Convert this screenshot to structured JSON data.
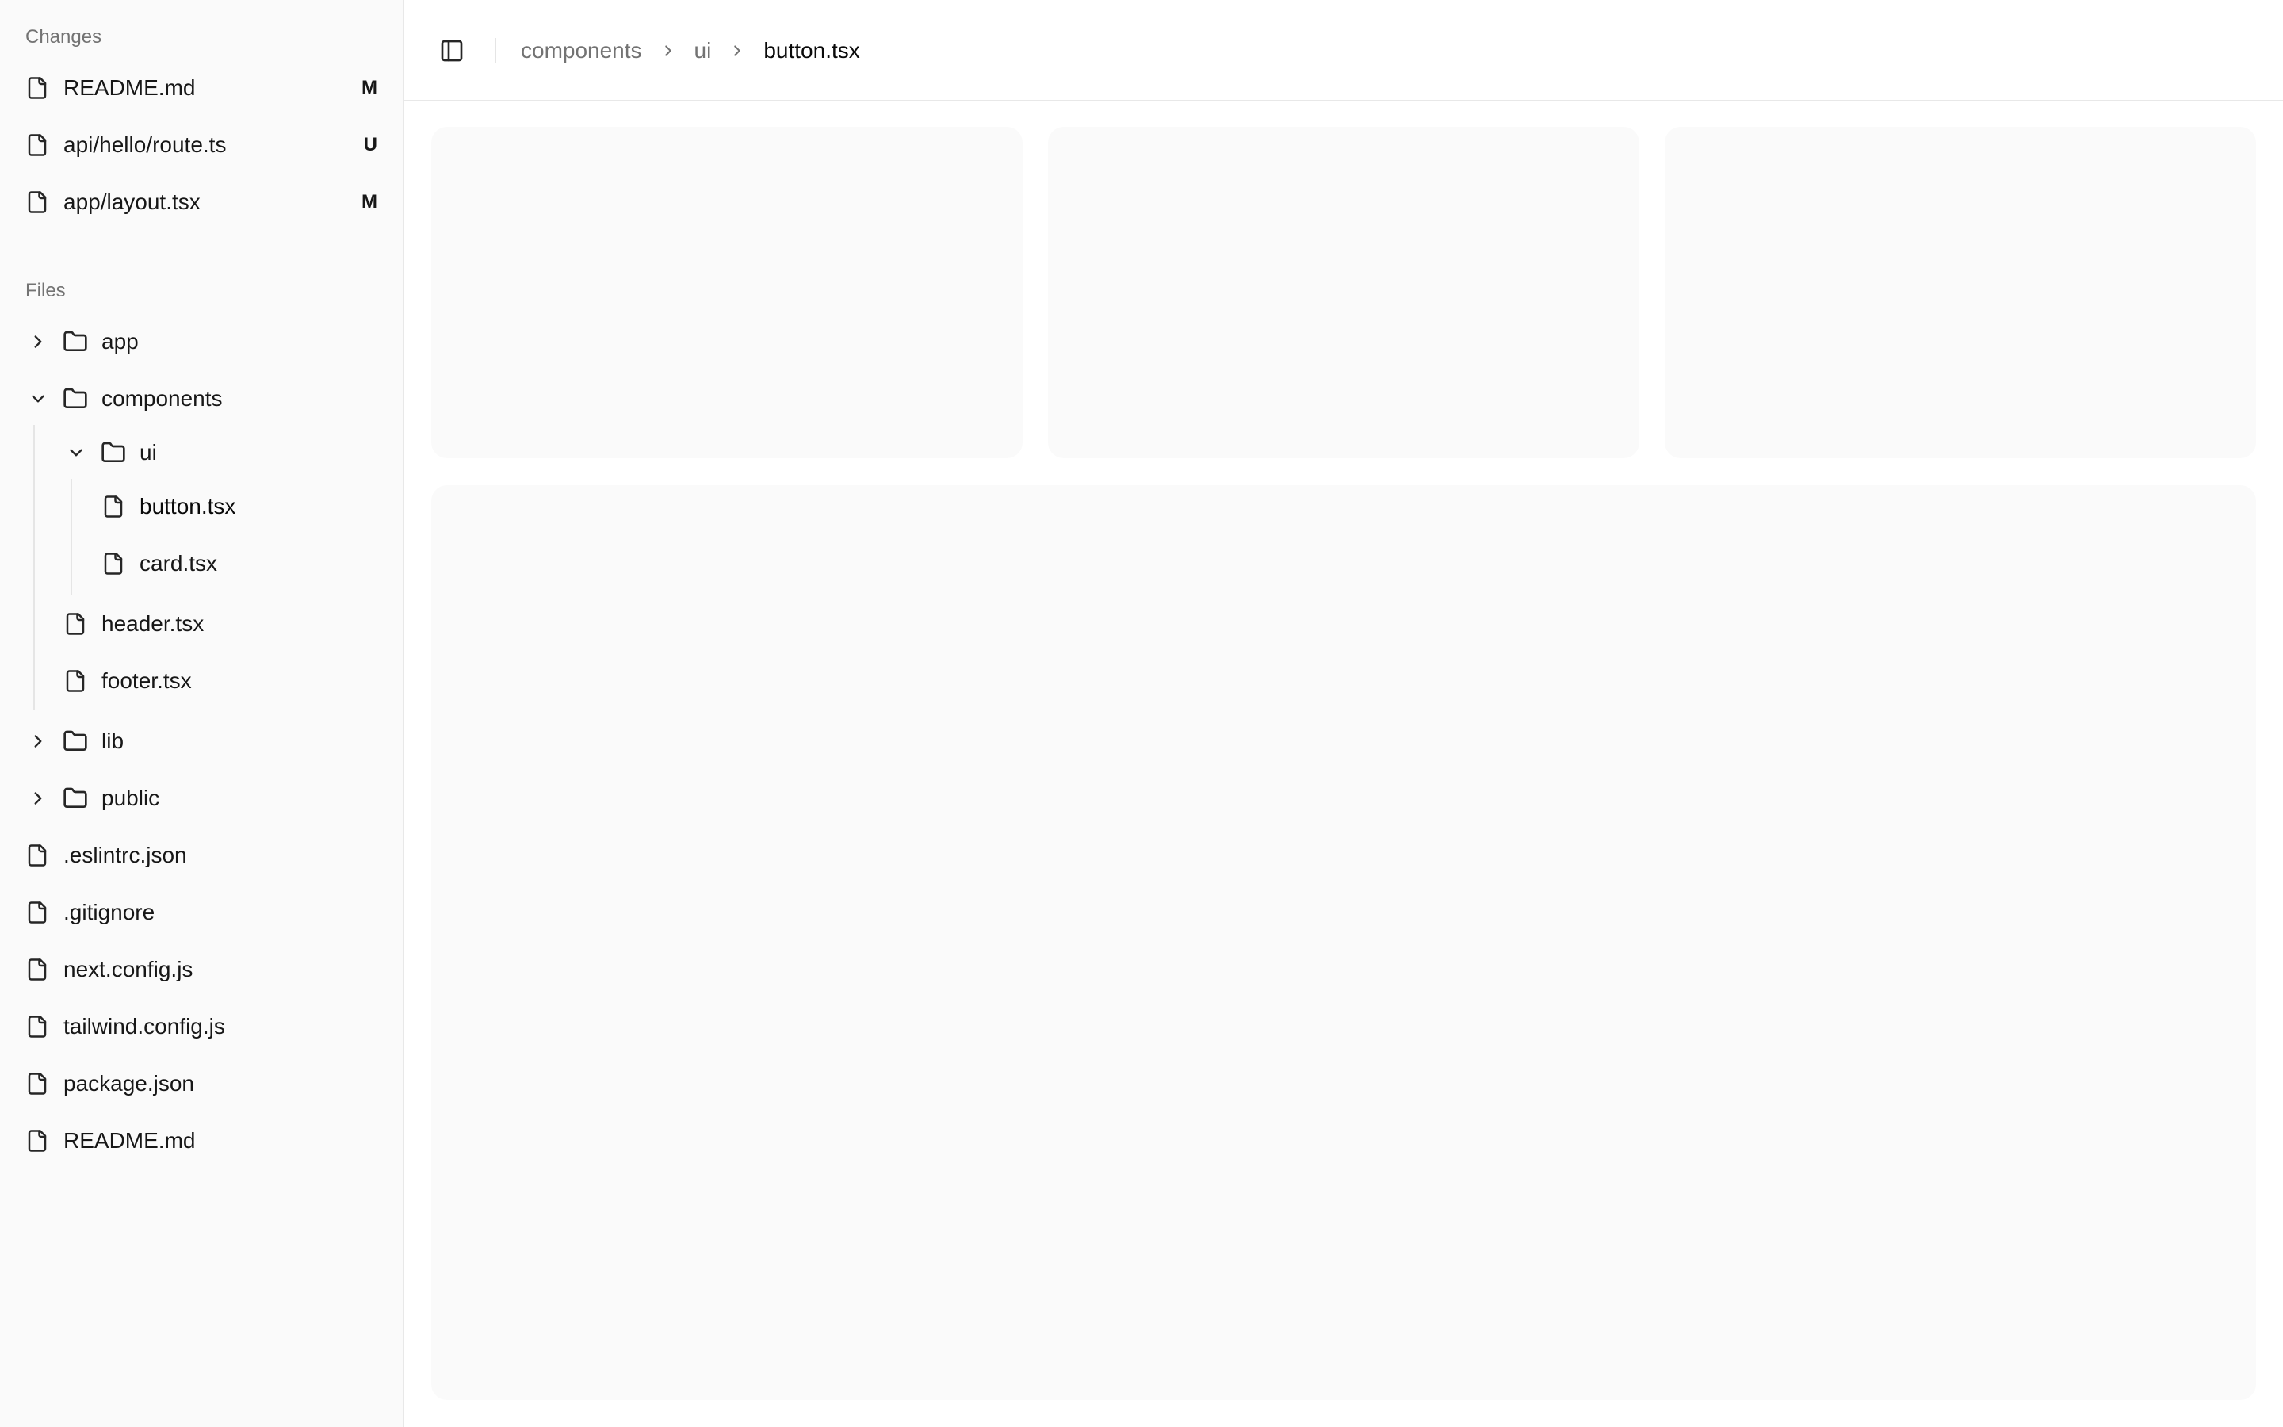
{
  "sidebar": {
    "changes_label": "Changes",
    "changes": [
      {
        "label": "README.md",
        "badge": "M",
        "icon": "file-icon"
      },
      {
        "label": "api/hello/route.ts",
        "badge": "U",
        "icon": "file-icon"
      },
      {
        "label": "app/layout.tsx",
        "badge": "M",
        "icon": "file-icon"
      }
    ],
    "files_label": "Files",
    "tree": [
      {
        "label": "app",
        "type": "folder",
        "expanded": false
      },
      {
        "label": "components",
        "type": "folder",
        "expanded": true
      },
      {
        "label": "ui",
        "type": "folder",
        "expanded": true
      },
      {
        "label": "button.tsx",
        "type": "file"
      },
      {
        "label": "card.tsx",
        "type": "file"
      },
      {
        "label": "header.tsx",
        "type": "file"
      },
      {
        "label": "footer.tsx",
        "type": "file"
      },
      {
        "label": "lib",
        "type": "folder",
        "expanded": false
      },
      {
        "label": "public",
        "type": "folder",
        "expanded": false
      },
      {
        "label": ".eslintrc.json",
        "type": "file"
      },
      {
        "label": ".gitignore",
        "type": "file"
      },
      {
        "label": "next.config.js",
        "type": "file"
      },
      {
        "label": "tailwind.config.js",
        "type": "file"
      },
      {
        "label": "package.json",
        "type": "file"
      },
      {
        "label": "README.md",
        "type": "file"
      }
    ]
  },
  "header": {
    "toggle_icon": "sidebar-toggle-icon",
    "breadcrumb": [
      "components",
      "ui",
      "button.tsx"
    ]
  },
  "colors": {
    "sidebar_bg": "#fafafa",
    "panel_bg": "#fafafa",
    "border": "#e8e8e8",
    "muted_text": "#737373",
    "text": "#171717"
  }
}
